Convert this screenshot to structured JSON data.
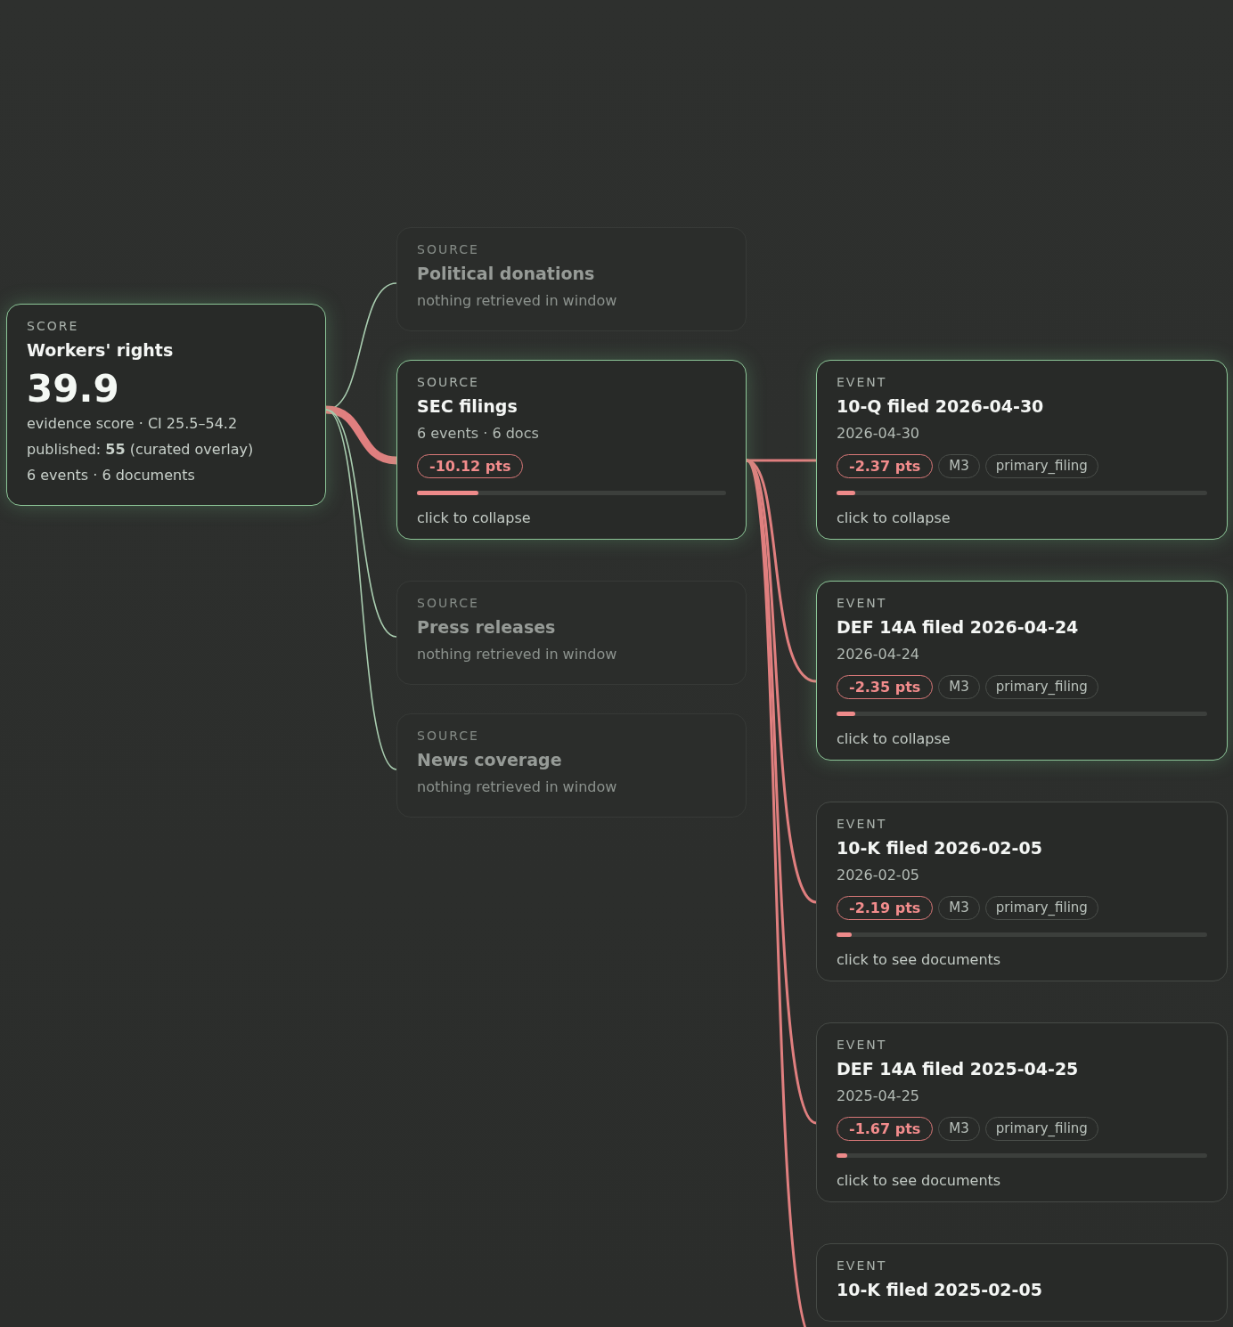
{
  "score": {
    "label": "SCORE",
    "title": "Workers' rights",
    "value": "39.9",
    "ci": "evidence score · CI 25.5–54.2",
    "published": "published: **55** (curated overlay)",
    "counts": "6 events · 6 documents"
  },
  "sources": [
    {
      "label": "SOURCE",
      "title": "Political donations",
      "active": false,
      "summary": "nothing retrieved in window"
    },
    {
      "label": "SOURCE",
      "title": "SEC filings",
      "active": true,
      "summary": "6 events · 6 docs",
      "delta": "-10.12 pts",
      "level": 0.2,
      "action": "click to collapse"
    },
    {
      "label": "SOURCE",
      "title": "Press releases",
      "active": false,
      "summary": "nothing retrieved in window"
    },
    {
      "label": "SOURCE",
      "title": "News coverage",
      "active": false,
      "summary": "nothing retrieved in window"
    }
  ],
  "events": [
    {
      "label": "EVENT",
      "title": "10-Q filed 2026-04-30",
      "expanded": true,
      "date": "2026-04-30",
      "delta": "-2.37 pts",
      "tags": [
        "M3",
        "primary_filing"
      ],
      "level": 0.05,
      "action": "click to collapse"
    },
    {
      "label": "EVENT",
      "title": "DEF 14A filed 2026-04-24",
      "expanded": true,
      "date": "2026-04-24",
      "delta": "-2.35 pts",
      "tags": [
        "M3",
        "primary_filing"
      ],
      "level": 0.05,
      "action": "click to collapse"
    },
    {
      "label": "EVENT",
      "title": "10-K filed 2026-02-05",
      "expanded": false,
      "date": "2026-02-05",
      "delta": "-2.19 pts",
      "tags": [
        "M3",
        "primary_filing"
      ],
      "level": 0.04,
      "action": "click to see documents"
    },
    {
      "label": "EVENT",
      "title": "DEF 14A filed 2025-04-25",
      "expanded": false,
      "date": "2025-04-25",
      "delta": "-1.67 pts",
      "tags": [
        "M3",
        "primary_filing"
      ],
      "level": 0.03,
      "action": "click to see documents"
    },
    {
      "label": "EVENT",
      "title": "10-K filed 2025-02-05",
      "expanded": false
    }
  ]
}
